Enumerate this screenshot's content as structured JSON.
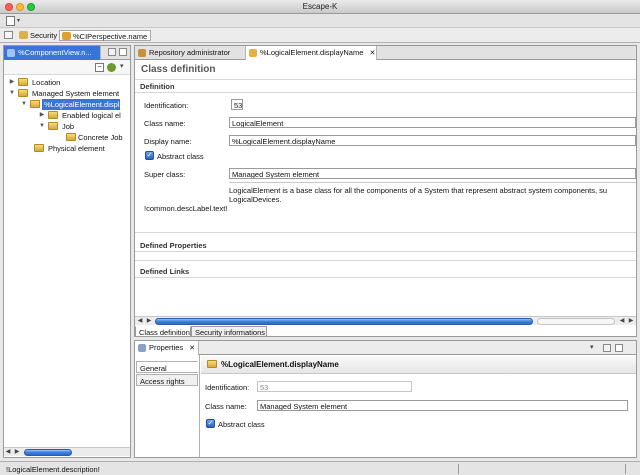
{
  "window": {
    "title": "Escape-K"
  },
  "toolbar": {
    "new_icon": "new-file-icon"
  },
  "perspectives": [
    {
      "label": "Security",
      "icon": "key-icon"
    },
    {
      "label": "%CIPerspective.name",
      "icon": "perspective-icon"
    }
  ],
  "component_view": {
    "tab_label": "%ComponentView.n...",
    "tree": [
      {
        "label": "Location",
        "level": 0,
        "expanded": false
      },
      {
        "label": "Managed System element",
        "level": 0,
        "expanded": true
      },
      {
        "label": "%LogicalElement.displ",
        "level": 1,
        "expanded": true,
        "selected": true
      },
      {
        "label": "Enabled logical el",
        "level": 2,
        "expanded": false
      },
      {
        "label": "Job",
        "level": 2,
        "expanded": true
      },
      {
        "label": "Concrete Job",
        "level": 3,
        "expanded": null
      },
      {
        "label": "Physical element",
        "level": 1,
        "expanded": null
      }
    ]
  },
  "editor": {
    "tabs": [
      {
        "label": "Repository administrator"
      },
      {
        "label": "%LogicalElement.displayName",
        "close": "✕"
      }
    ],
    "header": "Class definition",
    "definition_section": "Definition",
    "fields": {
      "identification_label": "Identification:",
      "identification_value": "53",
      "class_name_label": "Class name:",
      "class_name_value": "LogicalElement",
      "display_name_label": "Display name:",
      "display_name_value": "%LogicalElement.displayName",
      "abstract_label": "Abstract class",
      "super_class_label": "Super class:",
      "super_class_value": "Managed System element",
      "description_label": "!common.descLabel.text!",
      "description_line1": "LogicalElement is a base class for all the components of a System that represent abstract system components, su",
      "description_line2": "LogicalDevices."
    },
    "defined_properties": "Defined Properties",
    "defined_links": "Defined Links",
    "bottom_tabs": [
      "Class definition",
      "Security informations"
    ]
  },
  "properties": {
    "tab_label": "Properties",
    "close": "✕",
    "side_tabs": [
      "General",
      "Access rights"
    ],
    "title": "%LogicalElement.displayName",
    "identification_label": "Identification:",
    "identification_value": "53",
    "class_name_label": "Class name:",
    "class_name_value": "Managed System element",
    "abstract_label": "Abstract class"
  },
  "status": {
    "text": "!LogicalElement.description!"
  },
  "colors": {
    "accent": "#3a74d8",
    "selection": "#3a74d8"
  }
}
